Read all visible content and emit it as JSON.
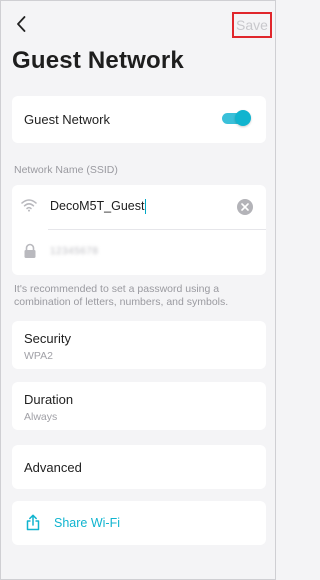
{
  "header": {
    "save_label": "Save",
    "title": "Guest Network"
  },
  "guest_toggle": {
    "label": "Guest Network",
    "enabled": true,
    "accent": "#10b4cf"
  },
  "network": {
    "section_label": "Network Name (SSID)",
    "ssid_value": "DecoM5T_Guest",
    "password_masked": "12345678",
    "hint": "It's recommended to set a password using a combination of letters, numbers, and symbols."
  },
  "settings": {
    "security_title": "Security",
    "security_value": "WPA2",
    "duration_title": "Duration",
    "duration_value": "Always",
    "advanced_label": "Advanced"
  },
  "share": {
    "label": "Share Wi-Fi"
  },
  "icons": {
    "back": "back-arrow-icon",
    "wifi": "wifi-icon",
    "clear": "clear-icon",
    "lock": "lock-icon",
    "share": "share-icon"
  },
  "colors": {
    "accent": "#10b4cf",
    "save_highlight": "#e0262c",
    "background": "#f4f4f6"
  }
}
